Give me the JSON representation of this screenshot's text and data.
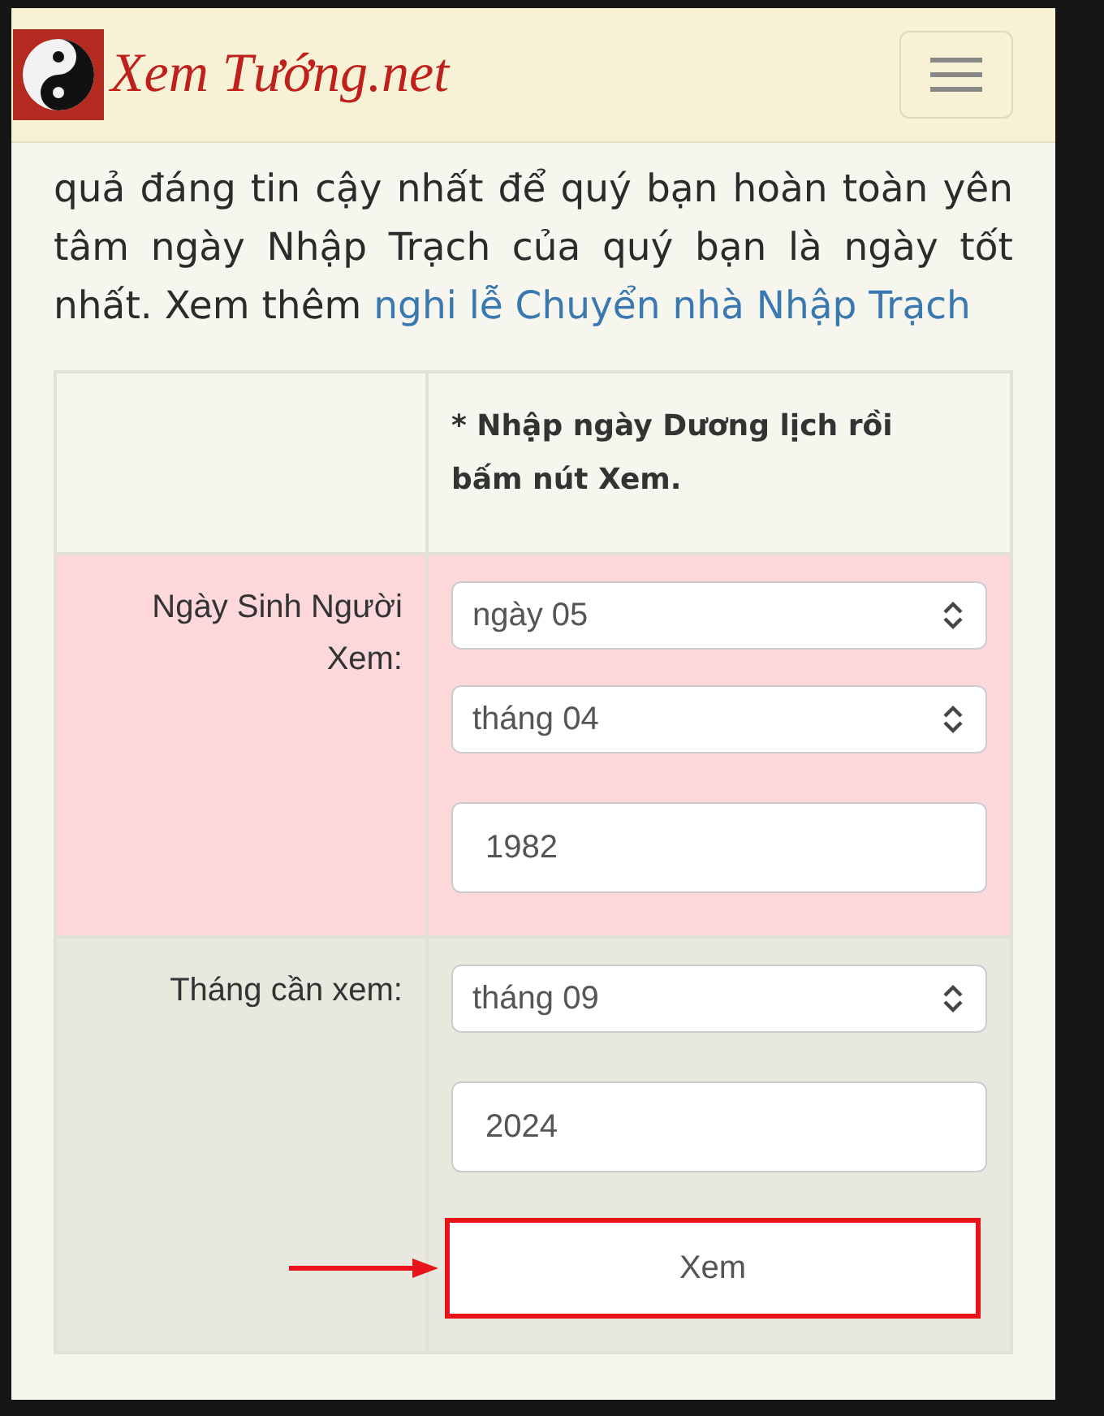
{
  "header": {
    "logo": "Xem Tướng.net"
  },
  "intro": {
    "text": "quả đáng tin cậy nhất để quý bạn hoàn toàn yên tâm ngày Nhập Trạch của quý bạn là ngày tốt nhất. Xem thêm ",
    "link": "nghi lễ Chuyển nhà Nhập Trạch"
  },
  "form": {
    "instruction": "* Nhập ngày Dương lịch rồi bấm nút Xem.",
    "sections": [
      {
        "label": "Ngày Sinh Người Xem:",
        "color": "#fdd8da",
        "fields": [
          {
            "kind": "select",
            "value": "ngày 05"
          },
          {
            "kind": "select",
            "value": "tháng 04"
          },
          {
            "kind": "input",
            "value": "1982"
          }
        ]
      },
      {
        "label": "Tháng cần xem:",
        "color": "#e9e8df",
        "fields": [
          {
            "kind": "select",
            "value": "tháng 09"
          },
          {
            "kind": "input",
            "value": "2024"
          }
        ]
      }
    ],
    "submit": {
      "label": "Xem",
      "highlighted": true
    }
  }
}
